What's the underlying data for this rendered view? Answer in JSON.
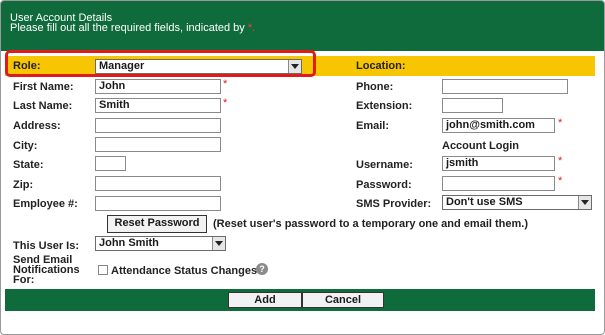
{
  "header": {
    "title": "User Account Details",
    "note": "Please fill out all the required fields, indicated by",
    "required_mark": "*."
  },
  "role": {
    "label": "Role:",
    "value": "Manager"
  },
  "location": {
    "label": "Location:"
  },
  "first_name": {
    "label": "First Name:",
    "value": "John"
  },
  "last_name": {
    "label": "Last Name:",
    "value": "Smith"
  },
  "address": {
    "label": "Address:",
    "value": ""
  },
  "city": {
    "label": "City:",
    "value": ""
  },
  "state": {
    "label": "State:",
    "value": ""
  },
  "zip": {
    "label": "Zip:",
    "value": ""
  },
  "employee_no": {
    "label": "Employee #:",
    "value": ""
  },
  "phone": {
    "label": "Phone:",
    "value": ""
  },
  "extension": {
    "label": "Extension:",
    "value": ""
  },
  "email": {
    "label": "Email:",
    "value": "john@smith.com"
  },
  "account_login": {
    "heading": "Account Login"
  },
  "username": {
    "label": "Username:",
    "value": "jsmith"
  },
  "password": {
    "label": "Password:",
    "value": ""
  },
  "sms_provider": {
    "label": "SMS Provider:",
    "value": "Don't use SMS"
  },
  "required_star": "*",
  "reset": {
    "button": "Reset Password",
    "note": "(Reset user's password to a temporary one and email them.)"
  },
  "this_user_is": {
    "label": "This User Is:",
    "value": "John Smith"
  },
  "send_email": {
    "label_line1": "Send Email",
    "label_line2": "Notifications",
    "label_line3": "For:",
    "option": "Attendance Status Changes"
  },
  "help_icon_glyph": "?",
  "actions": {
    "add": "Add",
    "cancel": "Cancel"
  },
  "colors": {
    "header_green": "#0f6b3c",
    "highlight_yellow": "#f7c600",
    "required_red": "#e11a1a"
  }
}
